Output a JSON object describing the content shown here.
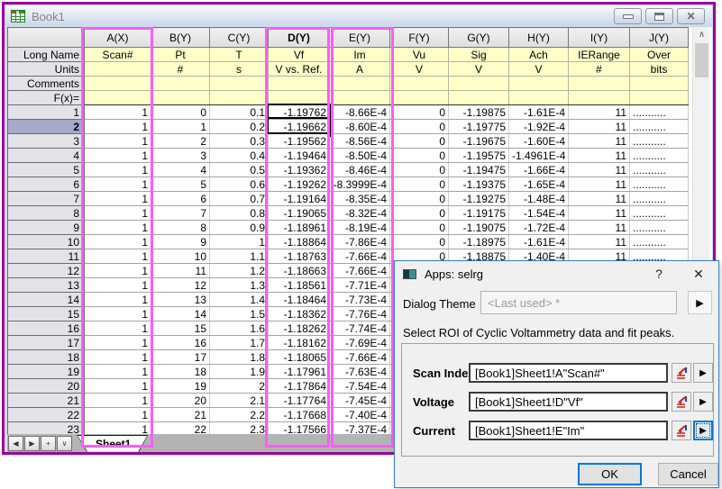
{
  "colors": {
    "roi_box": "#fa5cf8",
    "selected_header": "#a7a9ca",
    "accent": "#0078d7",
    "window_frame": "#9c009c",
    "label_row_bg": "#ffffca"
  },
  "book_window": {
    "title": "Book1",
    "close_icon": "✕",
    "sheet": {
      "columns": [
        "A(X)",
        "B(Y)",
        "C(Y)",
        "D(Y)",
        "E(Y)",
        "F(Y)",
        "G(Y)",
        "H(Y)",
        "I(Y)",
        "J(Y)"
      ],
      "selected_column_index": 3,
      "selected_row": "2",
      "active_cell": "D2",
      "label_rows": [
        {
          "label": "Long Name",
          "values": [
            "Scan#",
            "Pt",
            "T",
            "Vf",
            "Im",
            "Vu",
            "Sig",
            "Ach",
            "IERange",
            "Over"
          ]
        },
        {
          "label": "Units",
          "values": [
            "",
            "#",
            "s",
            "V vs. Ref.",
            "A",
            "V",
            "V",
            "V",
            "#",
            "bits"
          ]
        },
        {
          "label": "Comments",
          "values": [
            "",
            "",
            "",
            "",
            "",
            "",
            "",
            "",
            "",
            ""
          ]
        },
        {
          "label": "F(x)=",
          "values": [
            "",
            "",
            "",
            "",
            "",
            "",
            "",
            "",
            "",
            ""
          ]
        }
      ],
      "rows": [
        [
          "1",
          "1",
          "0",
          "0.1",
          "-1.19762",
          "-8.66E-4",
          "0",
          "-1.19875",
          "-1.61E-4",
          "11",
          "..........."
        ],
        [
          "2",
          "1",
          "1",
          "0.2",
          "-1.19662",
          "-8.60E-4",
          "0",
          "-1.19775",
          "-1.92E-4",
          "11",
          "..........."
        ],
        [
          "3",
          "1",
          "2",
          "0.3",
          "-1.19562",
          "-8.56E-4",
          "0",
          "-1.19675",
          "-1.60E-4",
          "11",
          "..........."
        ],
        [
          "4",
          "1",
          "3",
          "0.4",
          "-1.19464",
          "-8.50E-4",
          "0",
          "-1.19575",
          "-1.4961E-4",
          "11",
          "..........."
        ],
        [
          "5",
          "1",
          "4",
          "0.5",
          "-1.19362",
          "-8.46E-4",
          "0",
          "-1.19475",
          "-1.66E-4",
          "11",
          "..........."
        ],
        [
          "6",
          "1",
          "5",
          "0.6",
          "-1.19262",
          "-8.3999E-4",
          "0",
          "-1.19375",
          "-1.65E-4",
          "11",
          "..........."
        ],
        [
          "7",
          "1",
          "6",
          "0.7",
          "-1.19164",
          "-8.35E-4",
          "0",
          "-1.19275",
          "-1.48E-4",
          "11",
          "..........."
        ],
        [
          "8",
          "1",
          "7",
          "0.8",
          "-1.19065",
          "-8.32E-4",
          "0",
          "-1.19175",
          "-1.54E-4",
          "11",
          "..........."
        ],
        [
          "9",
          "1",
          "8",
          "0.9",
          "-1.18961",
          "-8.19E-4",
          "0",
          "-1.19075",
          "-1.72E-4",
          "11",
          "..........."
        ],
        [
          "10",
          "1",
          "9",
          "1",
          "-1.18864",
          "-7.86E-4",
          "0",
          "-1.18975",
          "-1.61E-4",
          "11",
          "..........."
        ],
        [
          "11",
          "1",
          "10",
          "1.1",
          "-1.18763",
          "-7.66E-4",
          "0",
          "-1.18875",
          "-1.40E-4",
          "11",
          "..........."
        ],
        [
          "12",
          "1",
          "11",
          "1.2",
          "-1.18663",
          "-7.66E-4",
          "",
          "",
          "",
          "",
          ""
        ],
        [
          "13",
          "1",
          "12",
          "1.3",
          "-1.18561",
          "-7.71E-4",
          "",
          "",
          "",
          "",
          ""
        ],
        [
          "14",
          "1",
          "13",
          "1.4",
          "-1.18464",
          "-7.73E-4",
          "",
          "",
          "",
          "",
          ""
        ],
        [
          "15",
          "1",
          "14",
          "1.5",
          "-1.18362",
          "-7.76E-4",
          "",
          "",
          "",
          "",
          ""
        ],
        [
          "16",
          "1",
          "15",
          "1.6",
          "-1.18262",
          "-7.74E-4",
          "",
          "",
          "",
          "",
          ""
        ],
        [
          "17",
          "1",
          "16",
          "1.7",
          "-1.18162",
          "-7.69E-4",
          "",
          "",
          "",
          "",
          ""
        ],
        [
          "18",
          "1",
          "17",
          "1.8",
          "-1.18065",
          "-7.66E-4",
          "",
          "",
          "",
          "",
          ""
        ],
        [
          "19",
          "1",
          "18",
          "1.9",
          "-1.17961",
          "-7.63E-4",
          "",
          "",
          "",
          "",
          ""
        ],
        [
          "20",
          "1",
          "19",
          "2",
          "-1.17864",
          "-7.54E-4",
          "",
          "",
          "",
          "",
          ""
        ],
        [
          "21",
          "1",
          "20",
          "2.1",
          "-1.17764",
          "-7.45E-4",
          "",
          "",
          "",
          "",
          ""
        ],
        [
          "22",
          "1",
          "21",
          "2.2",
          "-1.17668",
          "-7.40E-4",
          "",
          "",
          "",
          "",
          ""
        ],
        [
          "23",
          "1",
          "22",
          "2.3",
          "-1.17566",
          "-7.37E-4",
          "",
          "",
          "",
          "",
          ""
        ]
      ],
      "tab": "Sheet1",
      "nav_icons": [
        "◀",
        "▶",
        "+",
        "∨"
      ],
      "scroll_up_icon": "∧",
      "scroll_down_icon": "∨"
    }
  },
  "dialog": {
    "title": "Apps: selrg",
    "help_icon": "?",
    "close_icon": "✕",
    "theme_label": "Dialog Theme",
    "theme_value": "<Last used> *",
    "flyout_icon": "▶",
    "description": "Select ROI of Cyclic Voltammetry data and fit peaks.",
    "fields": [
      {
        "label": "Scan Index",
        "value": "[Book1]Sheet1!A\"Scan#\""
      },
      {
        "label": "Voltage",
        "value": "[Book1]Sheet1!D\"Vf\""
      },
      {
        "label": "Current",
        "value": "[Book1]Sheet1!E\"Im\""
      }
    ],
    "arrow_icon": "▶",
    "ok_label": "OK",
    "cancel_label": "Cancel"
  }
}
